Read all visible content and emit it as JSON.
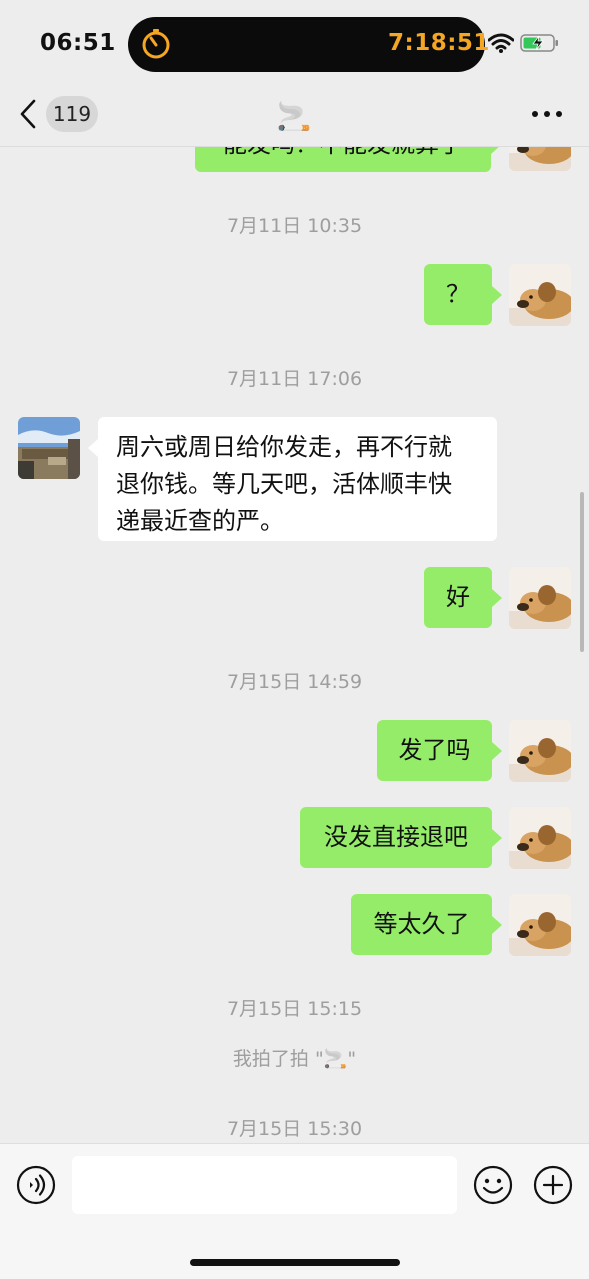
{
  "status_bar": {
    "time": "06:51",
    "timer": "7:18:51",
    "icons": [
      "stopwatch-icon",
      "wifi-icon",
      "battery-charging-icon"
    ]
  },
  "nav": {
    "unread_count": "119",
    "title": "🚬",
    "icons": [
      "back-chevron-icon",
      "more-icon"
    ]
  },
  "chat": {
    "partial_message": "能发吗？不能发就算了",
    "items": [
      {
        "type": "time",
        "text": "7月11日 10:35"
      },
      {
        "type": "msg",
        "sender": "me",
        "text": "？"
      },
      {
        "type": "time",
        "text": "7月11日 17:06"
      },
      {
        "type": "msg",
        "sender": "them",
        "lines": [
          "周六或周日给你发走，再不行就",
          "退你钱。等几天吧，活体顺丰快",
          "递最近查的严。"
        ]
      },
      {
        "type": "msg",
        "sender": "me",
        "text": "好"
      },
      {
        "type": "time",
        "text": "7月15日 14:59"
      },
      {
        "type": "msg",
        "sender": "me",
        "text": "发了吗"
      },
      {
        "type": "msg",
        "sender": "me",
        "text": "没发直接退吧"
      },
      {
        "type": "msg",
        "sender": "me",
        "text": "等太久了"
      },
      {
        "type": "time",
        "text": "7月15日 15:15"
      },
      {
        "type": "system",
        "text": "我拍了拍 \"🚬\""
      },
      {
        "type": "time",
        "text": "7月15日 15:30"
      }
    ]
  },
  "input_bar": {
    "placeholder": "",
    "icons": [
      "voice-icon",
      "emoji-icon",
      "plus-icon"
    ]
  },
  "colors": {
    "background": "#ededed",
    "my_bubble": "#95ec69",
    "their_bubble": "#ffffff",
    "timer": "#f5a623"
  }
}
